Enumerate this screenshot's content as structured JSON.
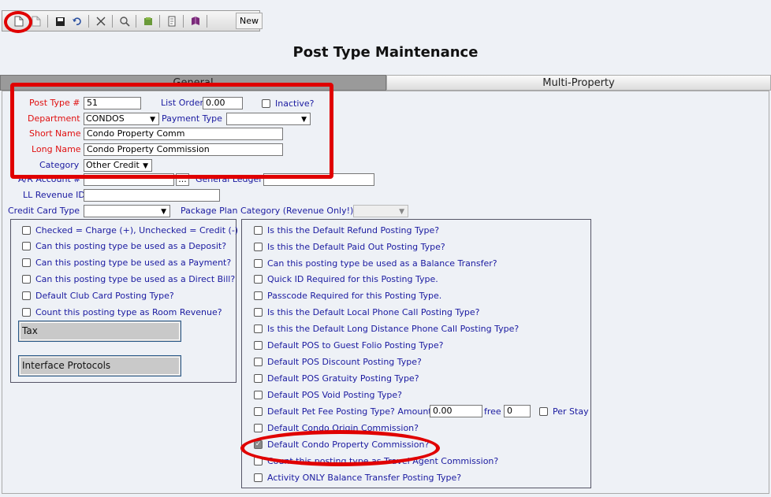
{
  "toolbar": {
    "new_label": "New",
    "icons": [
      "new-document-icon",
      "copy-document-icon",
      "save-icon",
      "undo-icon",
      "delete-icon",
      "search-icon",
      "tools-icon",
      "page-icon",
      "book-icon"
    ]
  },
  "page_title": "Post Type Maintenance",
  "tabs": [
    {
      "label": "General"
    },
    {
      "label": "Multi-Property"
    }
  ],
  "form": {
    "post_type_label": "Post Type #",
    "post_type_value": "51",
    "list_order_label": "List Order",
    "list_order_value": "0.00",
    "inactive_label": "Inactive?",
    "department_label": "Department",
    "department_value": "CONDOS",
    "payment_type_label": "Payment Type",
    "payment_type_value": "",
    "short_name_label": "Short Name",
    "short_name_value": "Condo Property Comm",
    "long_name_label": "Long Name",
    "long_name_value": "Condo Property Commission",
    "category_label": "Category",
    "category_value": "Other Credit",
    "ar_account_label": "A/R Account #",
    "ar_account_value": "",
    "browse_label": "...",
    "general_ledger_label": "General Ledger",
    "general_ledger_value": "",
    "ll_revenue_label": "LL Revenue ID",
    "ll_revenue_value": "",
    "credit_card_label": "Credit Card Type",
    "credit_card_value": "",
    "package_plan_label": "Package Plan Category (Revenue Only!)",
    "package_plan_value": ""
  },
  "left_checks": [
    {
      "label": "Checked = Charge (+), Unchecked = Credit (-)",
      "checked": false
    },
    {
      "label": "Can this posting type be used as a Deposit?",
      "checked": false
    },
    {
      "label": "Can this posting type be used as a Payment?",
      "checked": false
    },
    {
      "label": "Can this posting type be used as a Direct Bill?",
      "checked": false
    },
    {
      "label": "Default Club Card Posting Type?",
      "checked": false
    },
    {
      "label": "Count this posting type as Room Revenue?",
      "checked": false
    }
  ],
  "left_buttons": {
    "tax": "Tax",
    "interface": "Interface Protocols"
  },
  "right_checks": [
    {
      "label": "Is this the Default Refund Posting Type?",
      "checked": false
    },
    {
      "label": "Is this the Default Paid Out Posting Type?",
      "checked": false
    },
    {
      "label": "Can this posting type be used as a Balance Transfer?",
      "checked": false
    },
    {
      "label": "Quick ID Required for this Posting Type.",
      "checked": false
    },
    {
      "label": "Passcode Required for this Posting Type.",
      "checked": false
    },
    {
      "label": "Is this the Default Local Phone Call Posting Type?",
      "checked": false
    },
    {
      "label": "Is this the Default Long Distance Phone Call Posting Type?",
      "checked": false
    },
    {
      "label": "Default POS to Guest Folio Posting Type?",
      "checked": false
    },
    {
      "label": "Default POS Discount Posting Type?",
      "checked": false
    },
    {
      "label": "Default POS Gratuity Posting Type?",
      "checked": false
    },
    {
      "label": "Default POS Void Posting Type?",
      "checked": false
    }
  ],
  "pet_fee": {
    "label": "Default Pet Fee Posting Type? Amount",
    "amount": "0.00",
    "free_label": "free",
    "free_value": "0",
    "per_stay_label": "Per Stay"
  },
  "right_checks_2": [
    {
      "label": "Default Condo Origin Commission?",
      "checked": false
    },
    {
      "label": "Default Condo Property Commission?",
      "checked": true
    },
    {
      "label": "Count this posting type as Travel Agent Commission?",
      "checked": false
    },
    {
      "label": "Activity ONLY Balance Transfer Posting Type?",
      "checked": false
    }
  ],
  "colors": {
    "label_red": "#e01010",
    "label_blue": "#1a1aa0",
    "highlight": "#e00000"
  }
}
